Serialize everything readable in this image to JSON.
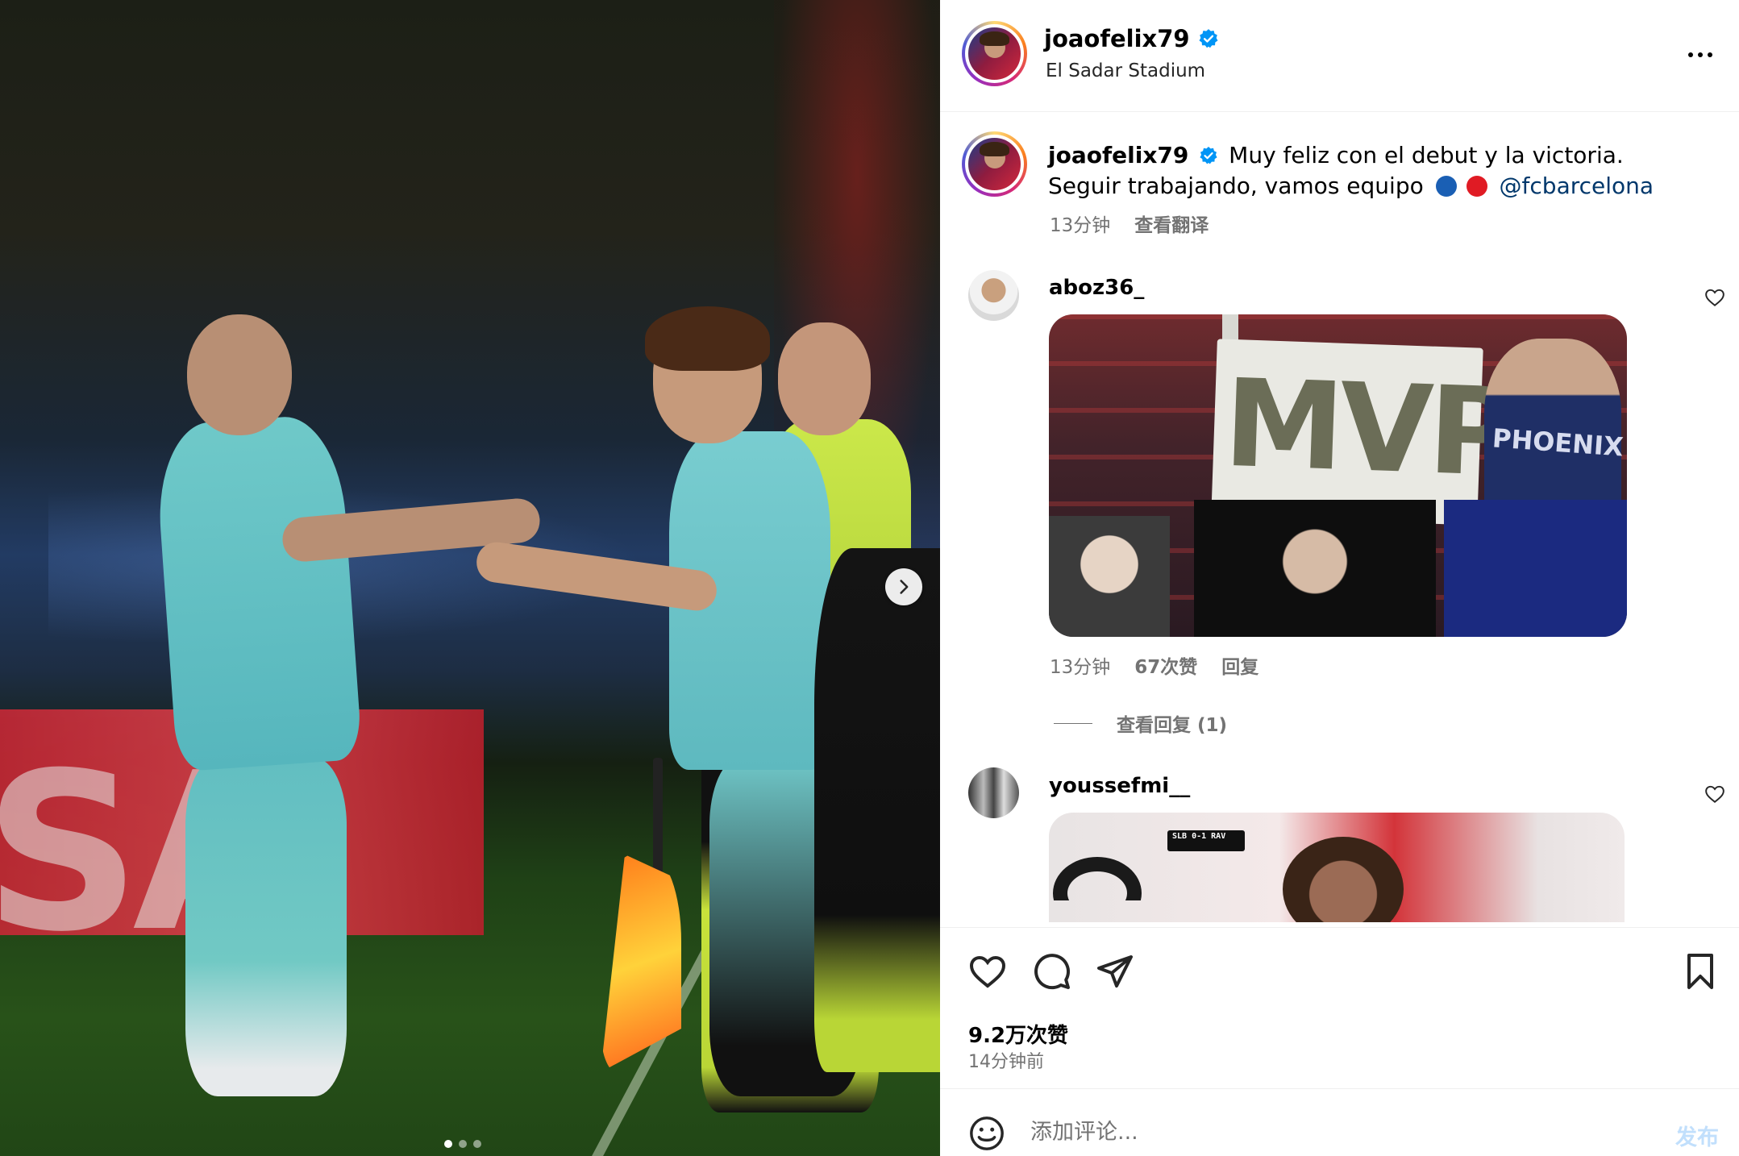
{
  "post": {
    "author": "joaofelix79",
    "location": "El Sadar Stadium",
    "verified": true,
    "media_count": 3,
    "media_active_index": 0,
    "photo_description_icons": [
      "carousel-next-icon"
    ]
  },
  "caption": {
    "username": "joaofelix79",
    "line1": "Muy feliz con el debut y la victoria.",
    "line2": "Seguir trabajando, vamos equipo",
    "emoji_colors": [
      "#1a5fb4",
      "#e01b24"
    ],
    "mention": "@fcbarcelona",
    "time": "13分钟",
    "translate": "查看翻译"
  },
  "comments": [
    {
      "username": "aboz36_",
      "gif_text": "MVP",
      "gif_shirt_text": "PHOENIX",
      "time": "13分钟",
      "likes": "67次赞",
      "reply": "回复",
      "view_replies": "查看回复 (1)"
    },
    {
      "username": "youssefmi__",
      "gif_score": "SLB 0-1 RAV"
    }
  ],
  "actions": {
    "likes": "9.2万次赞",
    "posted_ago": "14分钟前"
  },
  "composer": {
    "placeholder": "添加评论...",
    "post_label": "发布"
  },
  "colors": {
    "verified": "#0095f6",
    "link": "#00376b",
    "muted": "#737373",
    "post_disabled": "#c1dffc"
  }
}
